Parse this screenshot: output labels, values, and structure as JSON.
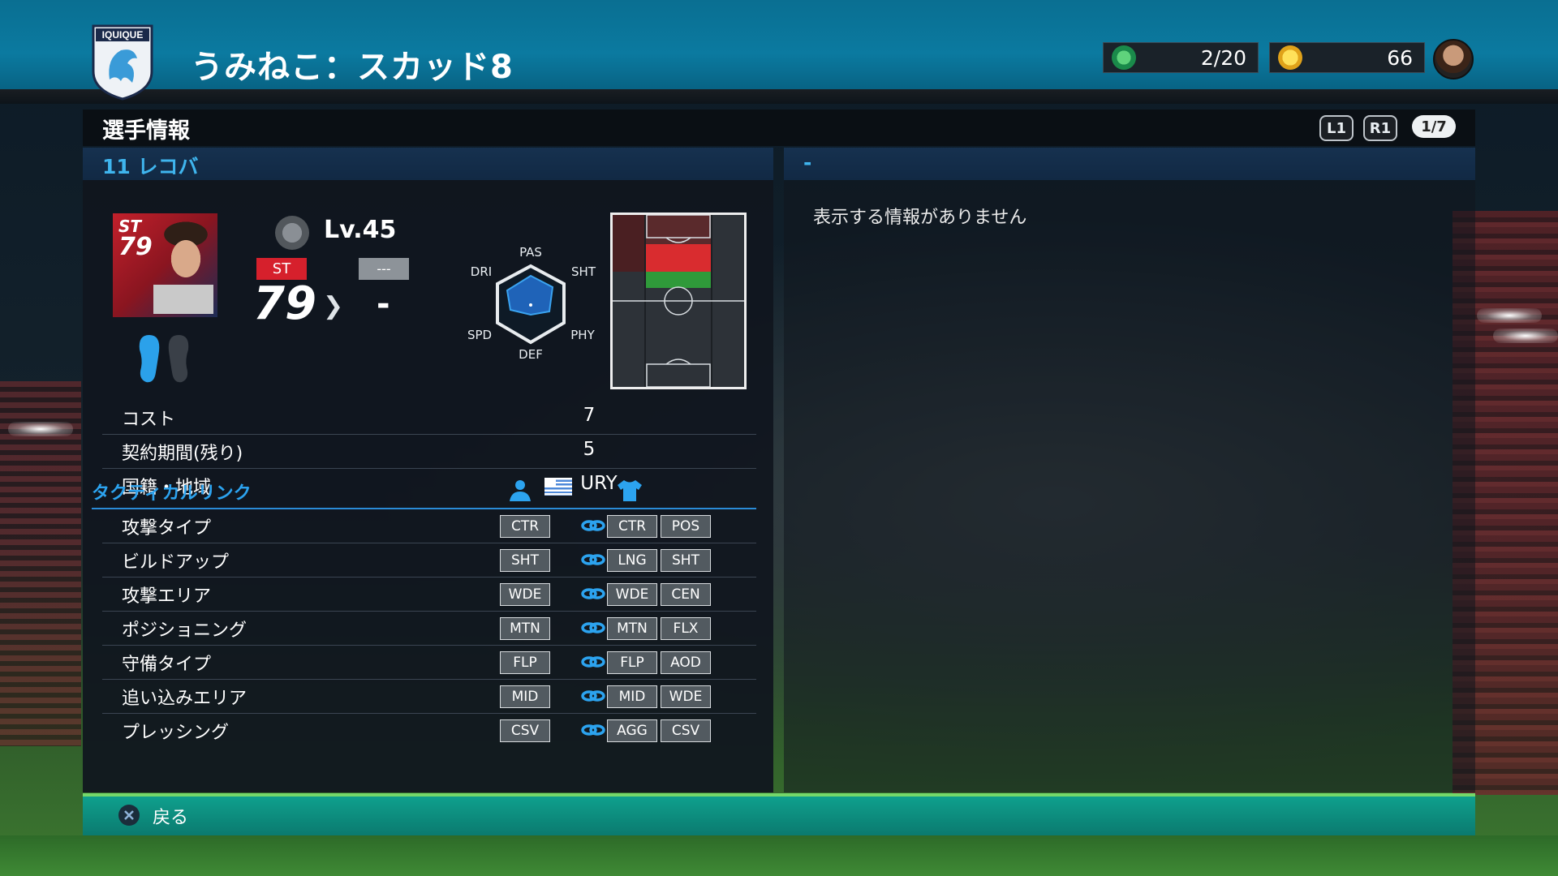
{
  "header": {
    "crest_text": "IQUIQUE",
    "title": "うみねこ：スカッド8",
    "counter_gp": "2/20",
    "counter_energy": "66",
    "icons": {
      "gp": "gp-icon",
      "energy": "energy-icon"
    }
  },
  "section": {
    "title": "選手情報",
    "l1": "L1",
    "r1": "R1",
    "page": "1/7"
  },
  "left_panel": {
    "header": "11 レコバ",
    "card": {
      "position": "ST",
      "rating": "79"
    },
    "level": "Lv.45",
    "pos_tag": "ST",
    "pos_tag2": "---",
    "rating_current": "79",
    "rating_next": "-",
    "radar_labels": {
      "pas": "PAS",
      "sht": "SHT",
      "phy": "PHY",
      "def": "DEF",
      "spd": "SPD",
      "dri": "DRI"
    },
    "info": [
      {
        "label": "コスト",
        "value": "7"
      },
      {
        "label": "契約期間(残り)",
        "value": "5"
      },
      {
        "label": "国籍・地域",
        "value": "URY"
      }
    ],
    "tactical": {
      "title": "タクティカルリンク",
      "rows": [
        {
          "label": "攻撃タイプ",
          "player": "CTR",
          "team1": "CTR",
          "team2": "POS"
        },
        {
          "label": "ビルドアップ",
          "player": "SHT",
          "team1": "LNG",
          "team2": "SHT"
        },
        {
          "label": "攻撃エリア",
          "player": "WDE",
          "team1": "WDE",
          "team2": "CEN"
        },
        {
          "label": "ポジショニング",
          "player": "MTN",
          "team1": "MTN",
          "team2": "FLX"
        },
        {
          "label": "守備タイプ",
          "player": "FLP",
          "team1": "FLP",
          "team2": "AOD"
        },
        {
          "label": "追い込みエリア",
          "player": "MID",
          "team1": "MID",
          "team2": "WDE"
        },
        {
          "label": "プレッシング",
          "player": "CSV",
          "team1": "AGG",
          "team2": "CSV"
        }
      ]
    }
  },
  "right_panel": {
    "header": "-",
    "message": "表示する情報がありません"
  },
  "footer": {
    "back_label": "戻る"
  },
  "colors": {
    "accent": "#2ca3ef",
    "header": "#0b7aa0",
    "footer": "#0fa08d",
    "st_red": "#d6202c"
  }
}
